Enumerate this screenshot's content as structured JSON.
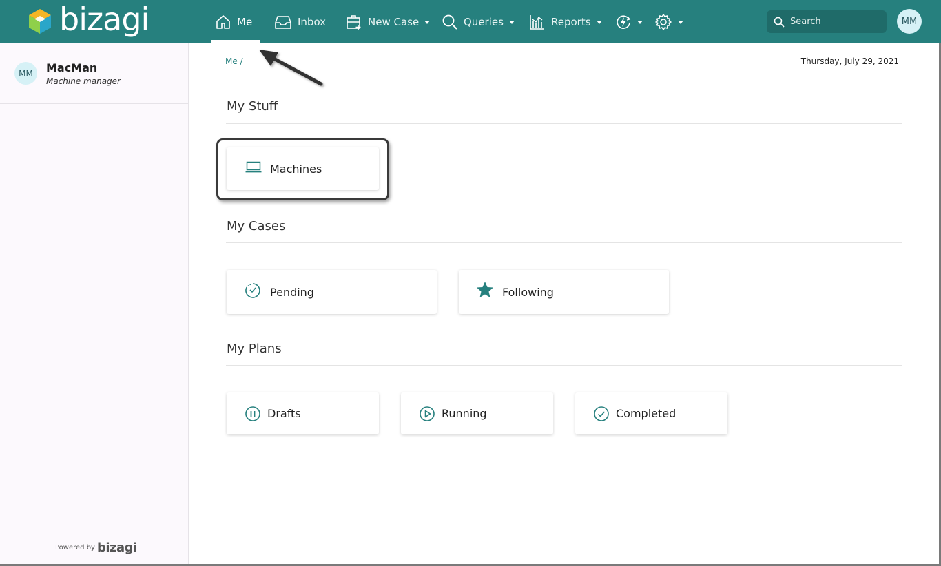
{
  "brand": {
    "name": "bizagi",
    "logo_colors": [
      "#8fd04a",
      "#f5b525",
      "#2aa6c9",
      "#ffffff"
    ]
  },
  "nav": {
    "items": [
      {
        "label": "Me",
        "icon": "home-icon",
        "active": true
      },
      {
        "label": "Inbox",
        "icon": "inbox-icon"
      },
      {
        "label": "New Case",
        "icon": "new-case-icon",
        "dropdown": true
      },
      {
        "label": "Queries",
        "icon": "search-icon",
        "dropdown": true
      },
      {
        "label": "Reports",
        "icon": "chart-icon",
        "dropdown": true
      },
      {
        "label": "",
        "icon": "bolt-icon",
        "dropdown": true
      },
      {
        "label": "",
        "icon": "gear-icon",
        "dropdown": true
      }
    ],
    "search_placeholder": "Search",
    "avatar": "MM"
  },
  "user": {
    "initials": "MM",
    "name": "MacMan",
    "role": "Machine manager"
  },
  "footer": {
    "powered_by": "Powered by",
    "logo": "bizagi"
  },
  "breadcrumb": "Me /",
  "date": "Thursday, July 29, 2021",
  "sections": {
    "my_stuff": {
      "title": "My Stuff",
      "cards": [
        {
          "label": "Machines",
          "icon": "laptop-icon"
        }
      ]
    },
    "my_cases": {
      "title": "My Cases",
      "cards": [
        {
          "label": "Pending",
          "icon": "timer-icon"
        },
        {
          "label": "Following",
          "icon": "star-icon"
        }
      ]
    },
    "my_plans": {
      "title": "My Plans",
      "cards": [
        {
          "label": "Drafts",
          "icon": "pause-icon"
        },
        {
          "label": "Running",
          "icon": "play-icon"
        },
        {
          "label": "Completed",
          "icon": "check-circle-icon"
        }
      ]
    }
  },
  "colors": {
    "header": "#26807e",
    "accent": "#26807e",
    "sidebar_bg": "#fcf9fd"
  }
}
